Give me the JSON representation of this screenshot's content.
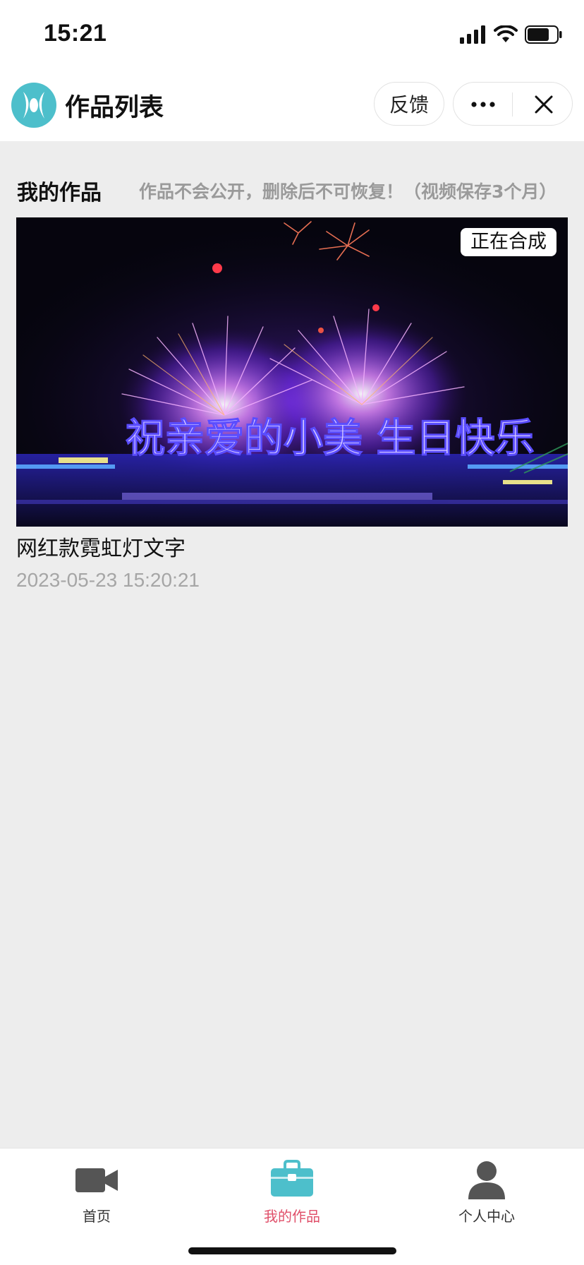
{
  "status_bar": {
    "time": "15:21"
  },
  "nav": {
    "title": "作品列表",
    "feedback_label": "反馈",
    "more_icon": "more-dots-icon",
    "close_icon": "close-icon"
  },
  "section": {
    "title": "我的作品",
    "note": "作品不会公开，删除后不可恢复！（视频保存3个月）"
  },
  "works": [
    {
      "status": "正在合成",
      "thumbnail_text": "祝亲爱的小美 生日快乐",
      "title": "网红款霓虹灯文字",
      "date": "2023-05-23 15:20:21"
    }
  ],
  "tabs": [
    {
      "label": "首页",
      "icon": "video-camera-icon",
      "active": false
    },
    {
      "label": "我的作品",
      "icon": "briefcase-icon",
      "active": true
    },
    {
      "label": "个人中心",
      "icon": "user-icon",
      "active": false
    }
  ],
  "colors": {
    "accent": "#4dbfcb",
    "active_tab_text": "#e0506a",
    "background": "#ededed"
  }
}
